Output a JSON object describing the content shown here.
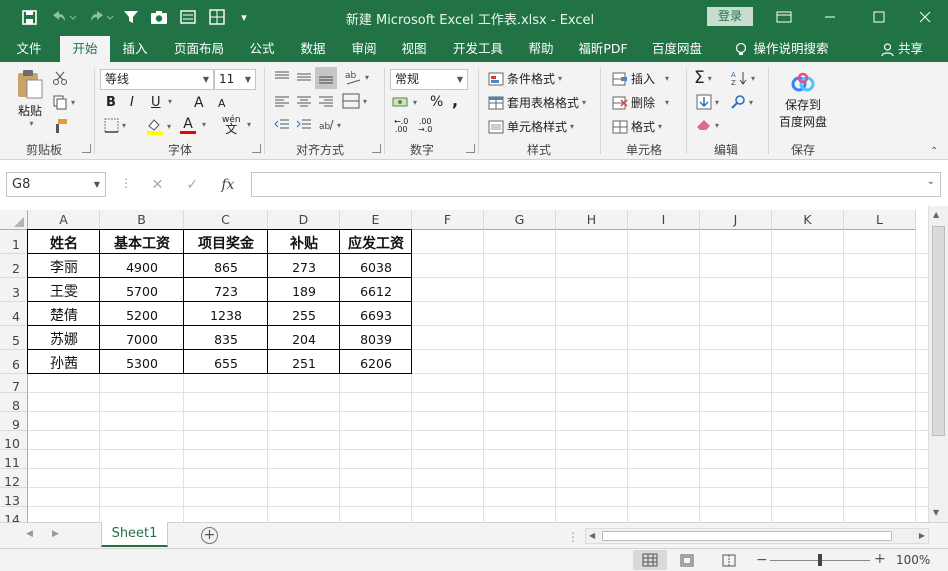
{
  "titlebar": {
    "title": "新建 Microsoft Excel 工作表.xlsx  -  Excel",
    "login_label": "登录",
    "qat_icons": [
      "save-icon",
      "undo-icon",
      "redo-icon",
      "filter-icon",
      "camera-icon",
      "form-icon",
      "table-icon",
      "customize-icon"
    ]
  },
  "tabs": [
    "文件",
    "开始",
    "插入",
    "页面布局",
    "公式",
    "数据",
    "审阅",
    "视图",
    "开发工具",
    "帮助",
    "福昕PDF",
    "百度网盘"
  ],
  "active_tab": "开始",
  "tell_me": "操作说明搜索",
  "share_label": "共享",
  "ribbon": {
    "clipboard": {
      "paste_label": "粘贴",
      "group_label": "剪贴板"
    },
    "font": {
      "font_name": "等线",
      "font_size": "11",
      "group_label": "字体",
      "bold": "B",
      "italic": "I",
      "underline": "U",
      "grow": "A",
      "shrink": "A",
      "font_color_letter": "A",
      "phonetic": "wén"
    },
    "alignment": {
      "group_label": "对齐方式"
    },
    "number": {
      "format": "常规",
      "group_label": "数字",
      "percent": "%",
      "comma": ","
    },
    "styles": {
      "conditional": "条件格式",
      "table": "套用表格格式",
      "cell": "单元格样式",
      "group_label": "样式"
    },
    "cells": {
      "insert": "插入",
      "delete": "删除",
      "format": "格式",
      "group_label": "单元格"
    },
    "editing": {
      "group_label": "编辑"
    },
    "save": {
      "line1": "保存到",
      "line2": "百度网盘",
      "group_label": "保存"
    }
  },
  "formula_bar": {
    "name_box": "G8",
    "fx": "fx",
    "value": ""
  },
  "columns": [
    "A",
    "B",
    "C",
    "D",
    "E",
    "F",
    "G",
    "H",
    "I",
    "J",
    "K",
    "L"
  ],
  "rows": [
    "1",
    "2",
    "3",
    "4",
    "5",
    "6",
    "7",
    "8",
    "9",
    "10",
    "11",
    "12",
    "13",
    "14"
  ],
  "table": {
    "headers": [
      "姓名",
      "基本工资",
      "项目奖金",
      "补贴",
      "应发工资"
    ],
    "rows": [
      [
        "李丽",
        "4900",
        "865",
        "273",
        "6038"
      ],
      [
        "王雯",
        "5700",
        "723",
        "189",
        "6612"
      ],
      [
        "楚倩",
        "5200",
        "1238",
        "255",
        "6693"
      ],
      [
        "苏娜",
        "7000",
        "835",
        "204",
        "8039"
      ],
      [
        "孙茜",
        "5300",
        "655",
        "251",
        "6206"
      ]
    ]
  },
  "sheet_tab": "Sheet1",
  "status": {
    "zoom": "100%",
    "zoom_fraction": 0.5
  }
}
